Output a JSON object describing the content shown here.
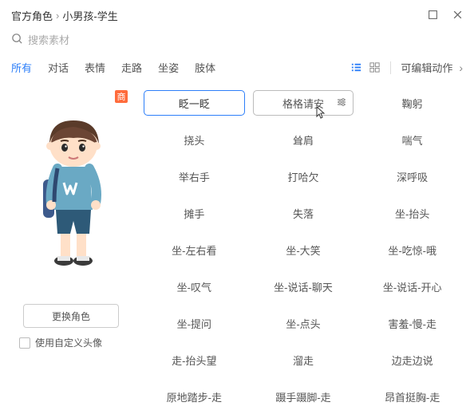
{
  "breadcrumb": {
    "root": "官方角色",
    "current": "小男孩-学生"
  },
  "search": {
    "placeholder": "搜索素材"
  },
  "tabs": [
    "所有",
    "对话",
    "表情",
    "走路",
    "坐姿",
    "肢体"
  ],
  "editable_label": "可编辑动作",
  "price_badge": "商",
  "change_char_label": "更换角色",
  "custom_avatar_label": "使用自定义头像",
  "actions": [
    "眨一眨",
    "格格请安",
    "鞠躬",
    "挠头",
    "耸肩",
    "喘气",
    "举右手",
    "打哈欠",
    "深呼吸",
    "摊手",
    "失落",
    "坐-抬头",
    "坐-左右看",
    "坐-大笑",
    "坐-吃惊-哦",
    "坐-叹气",
    "坐-说话-聊天",
    "坐-说话-开心",
    "坐-提问",
    "坐-点头",
    "害羞-慢-走",
    "走-抬头望",
    "溜走",
    "边走边说",
    "原地踏步-走",
    "蹑手蹑脚-走",
    "昂首挺胸-走"
  ],
  "colors": {
    "accent": "#2d7ff9",
    "badge": "#ff6b3b"
  }
}
